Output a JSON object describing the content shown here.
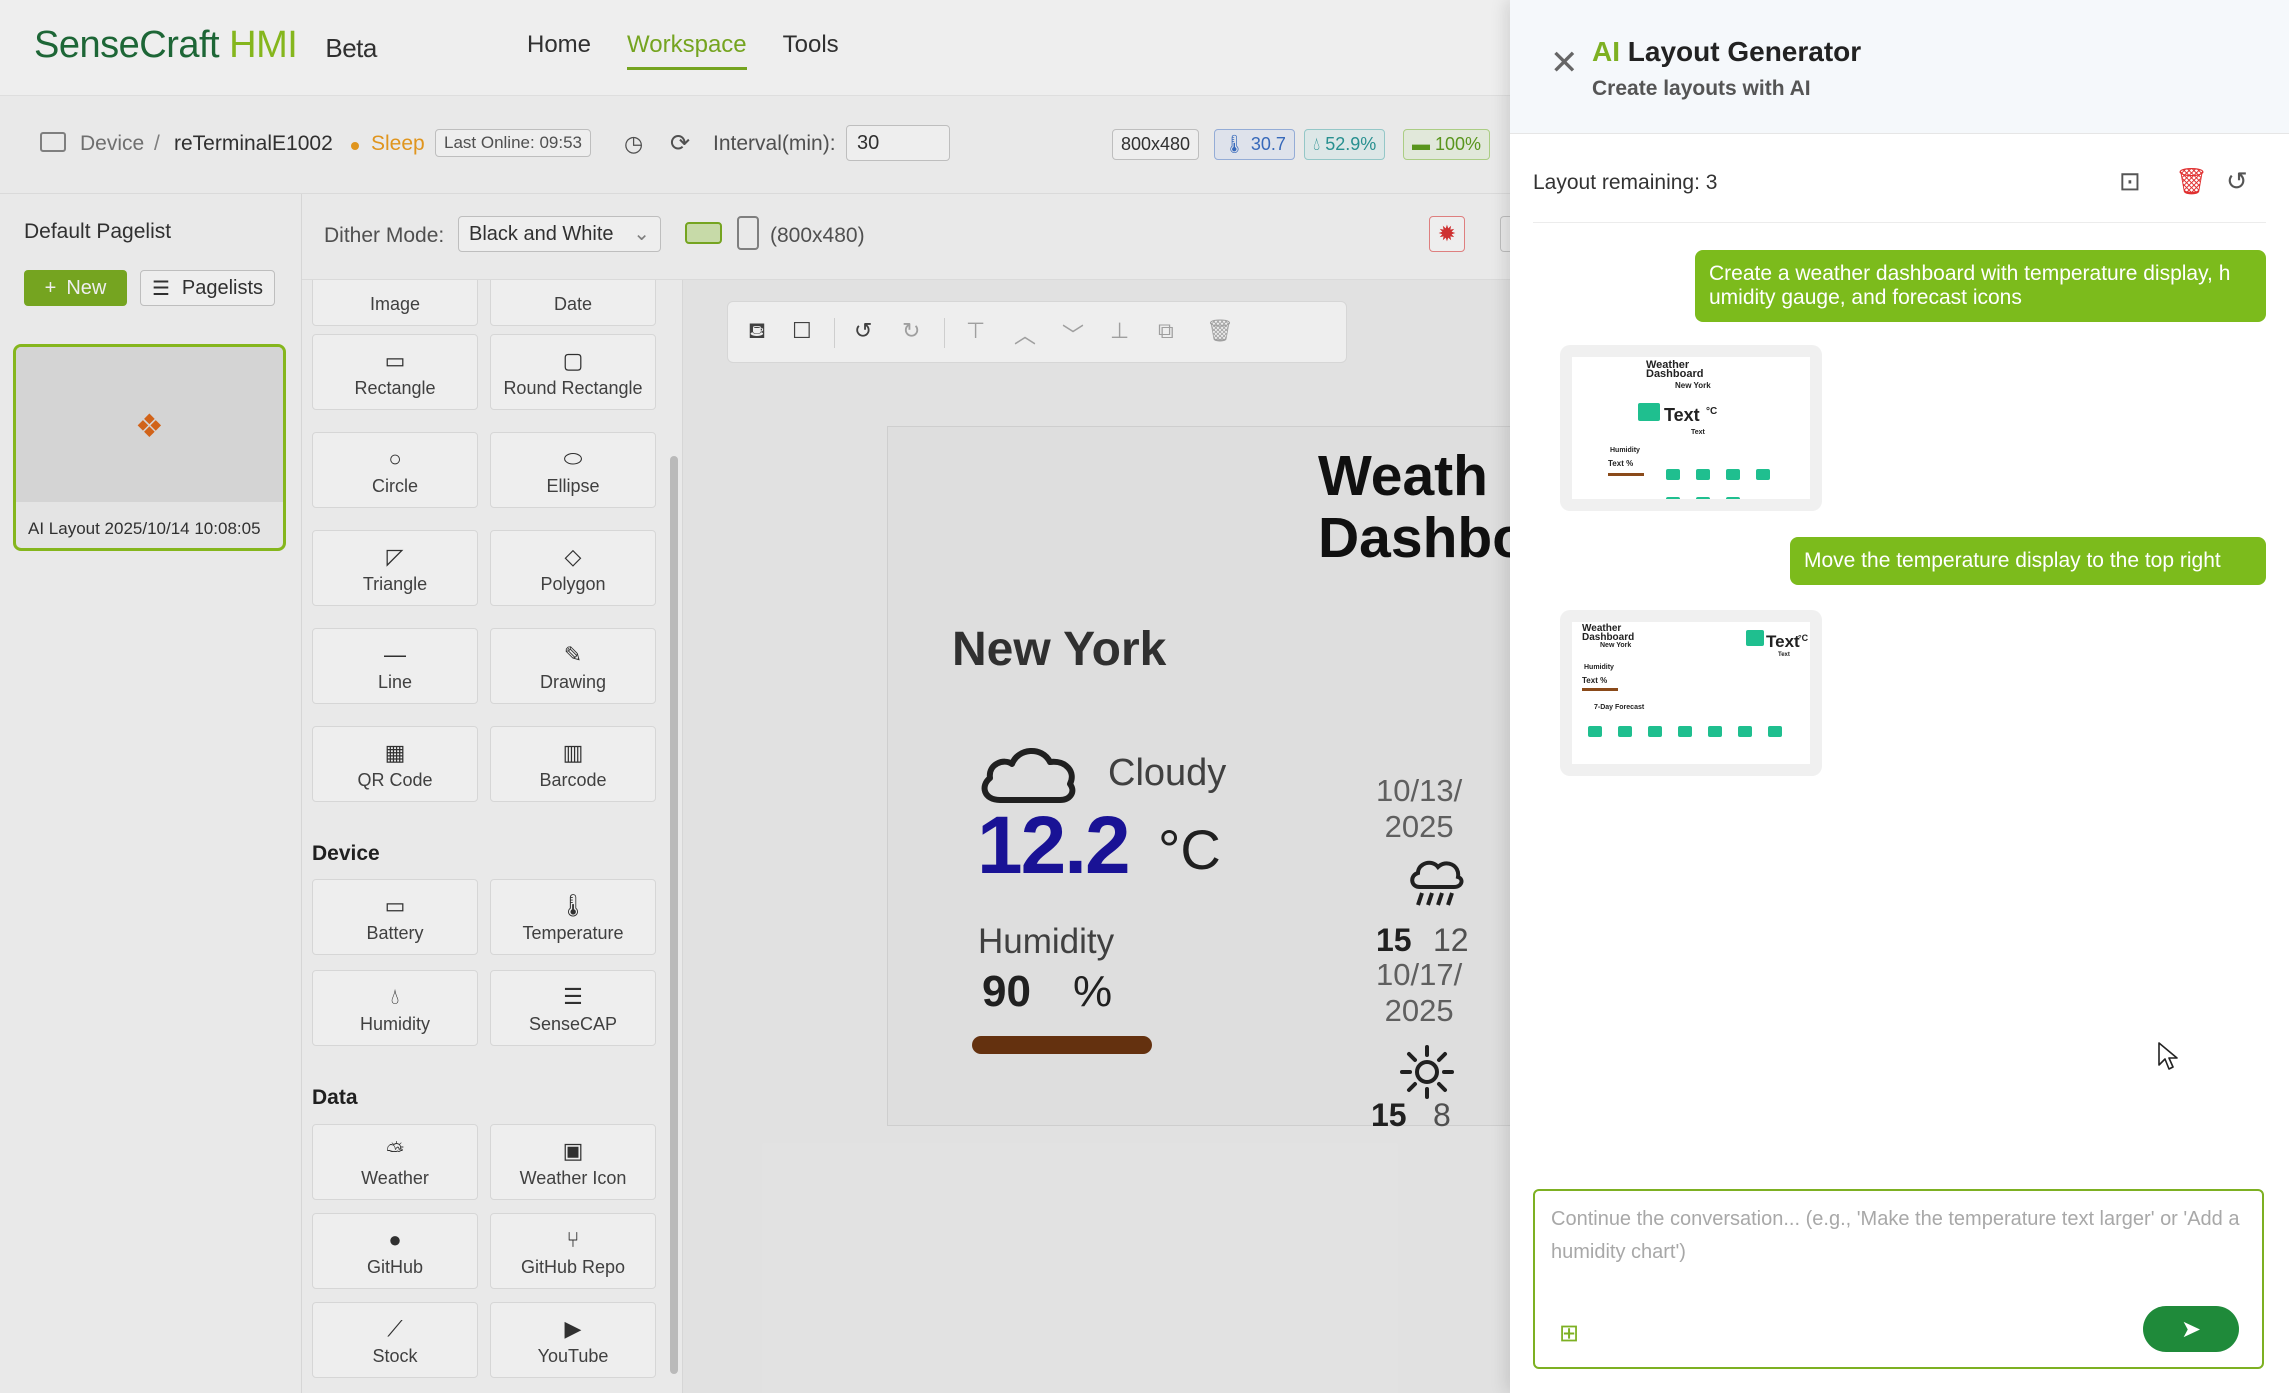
{
  "app": {
    "logo_part1": "SenseCraft",
    "logo_part2": "HMI",
    "beta": "Beta",
    "nav": [
      "Home",
      "Workspace",
      "Tools"
    ],
    "active_nav": "Workspace"
  },
  "device_bar": {
    "device_label": "Device",
    "separator": "/",
    "device_name": "reTerminalE1002",
    "status": "Sleep",
    "last_online": "Last Online: 09:53",
    "interval_label": "Interval(min):",
    "interval_value": "30",
    "resolution": "800x480",
    "temperature": "30.7",
    "humidity": "52.9%",
    "battery": "100%"
  },
  "pagelist": {
    "title": "Default Pagelist",
    "new_button": "New",
    "pagelists_button": "Pagelists",
    "pages": [
      {
        "caption": "AI Layout 2025/10/14 10:08:05"
      }
    ]
  },
  "dither": {
    "label": "Dither Mode:",
    "value": "Black and White",
    "resolution": "(800x480)"
  },
  "palette": {
    "basic": [
      {
        "icon": "image-icon",
        "label": "Image"
      },
      {
        "icon": "date-icon",
        "label": "Date"
      },
      {
        "icon": "rectangle-icon",
        "label": "Rectangle"
      },
      {
        "icon": "round-rectangle-icon",
        "label": "Round Rectangle"
      },
      {
        "icon": "circle-icon",
        "label": "Circle"
      },
      {
        "icon": "ellipse-icon",
        "label": "Ellipse"
      },
      {
        "icon": "triangle-icon",
        "label": "Triangle"
      },
      {
        "icon": "polygon-icon",
        "label": "Polygon"
      },
      {
        "icon": "line-icon",
        "label": "Line"
      },
      {
        "icon": "pencil-icon",
        "label": "Drawing"
      },
      {
        "icon": "qr-code-icon",
        "label": "QR Code"
      },
      {
        "icon": "barcode-icon",
        "label": "Barcode"
      }
    ],
    "device_section": "Device",
    "device": [
      {
        "icon": "battery-icon",
        "label": "Battery"
      },
      {
        "icon": "thermometer-icon",
        "label": "Temperature"
      },
      {
        "icon": "droplet-icon",
        "label": "Humidity"
      },
      {
        "icon": "sensecap-icon",
        "label": "SenseCAP"
      }
    ],
    "data_section": "Data",
    "data": [
      {
        "icon": "weather-icon",
        "label": "Weather"
      },
      {
        "icon": "weather-image-icon",
        "label": "Weather Icon"
      },
      {
        "icon": "github-icon",
        "label": "GitHub"
      },
      {
        "icon": "git-branch-icon",
        "label": "GitHub Repo"
      },
      {
        "icon": "chart-icon",
        "label": "Stock"
      },
      {
        "icon": "youtube-icon",
        "label": "YouTube"
      }
    ]
  },
  "canvas": {
    "title_line1": "Weath",
    "title_line2": "Dashbo",
    "city": "New York",
    "condition": "Cloudy",
    "temperature": "12.2",
    "unit": "°C",
    "humidity_label": "Humidity",
    "humidity_value": "90",
    "humidity_unit": "%",
    "humidity_fraction": 0.9,
    "forecast": [
      {
        "date_line1": "10/13/",
        "date_line2": "2025",
        "icon": "rain-icon",
        "high": "15",
        "low": "12"
      },
      {
        "date_line1": "10/17/",
        "date_line2": "2025",
        "icon": "sun-icon",
        "high": "15",
        "low": "8"
      }
    ]
  },
  "drawer": {
    "title_ai": "AI",
    "title_rest": "Layout Generator",
    "subtitle": "Create layouts with AI",
    "remaining": "Layout remaining: 3",
    "messages": [
      {
        "role": "user",
        "text": "Create a weather dashboard with temperature display, h umidity gauge, and forecast icons"
      },
      {
        "role": "ai",
        "preview": "layout-preview-1"
      },
      {
        "role": "user",
        "text": "Move the temperature display to the top right"
      },
      {
        "role": "ai",
        "preview": "layout-preview-2"
      }
    ],
    "preview1": {
      "title_a": "Weather",
      "title_b": "Dashboard",
      "city": "New York",
      "temp": "Text",
      "unit": "°C",
      "cond": "Text",
      "hum_lbl": "Humidity",
      "hum_val": "Text %"
    },
    "preview2": {
      "title_a": "Weather",
      "title_b": "Dashboard",
      "city": "New York",
      "temp": "Text",
      "unit": "°C",
      "cond": "Text",
      "hum_lbl": "Humidity",
      "hum_val": "Text %",
      "forecast": "7-Day Forecast"
    },
    "input_placeholder": "Continue the conversation... (e.g., 'Make the temperature text larger' or 'Add a humidity chart')"
  },
  "colors": {
    "accent": "#7db022",
    "brand_dark": "#1f6d3a",
    "user_bubble": "#7cbb1c",
    "send_button": "#1f8a3a",
    "temperature_text": "#1a13a0",
    "humidity_bar": "#6b3410"
  }
}
